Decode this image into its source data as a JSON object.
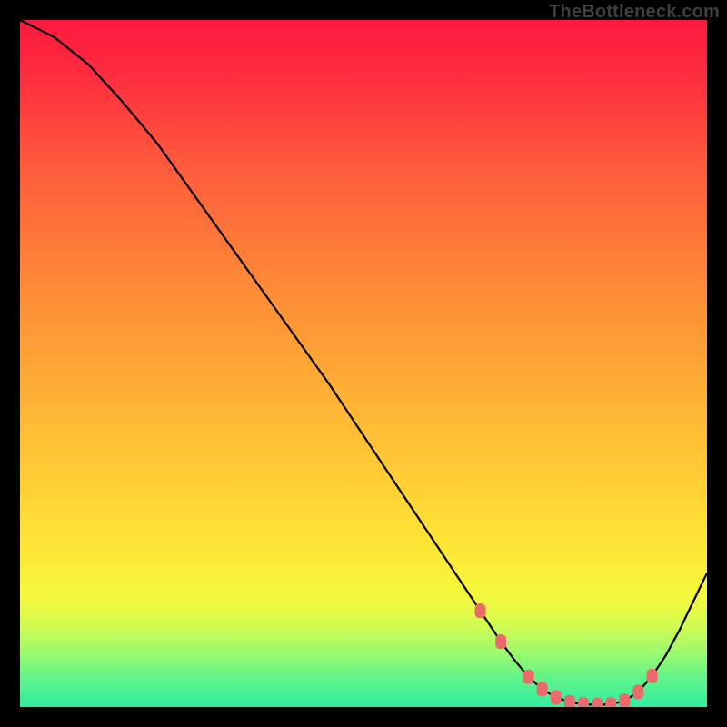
{
  "watermark": "TheBottleneck.com",
  "chart_data": {
    "type": "line",
    "title": "",
    "xlabel": "",
    "ylabel": "",
    "x": [
      0,
      5,
      10,
      15,
      20,
      25,
      30,
      35,
      40,
      45,
      50,
      55,
      60,
      65,
      67,
      70,
      72,
      74,
      76,
      78,
      80,
      82,
      84,
      86,
      88,
      90,
      92,
      94,
      96,
      100
    ],
    "values": [
      100,
      97.5,
      93.5,
      88,
      82,
      75,
      68,
      61,
      54,
      47,
      39.5,
      32,
      24.5,
      17,
      14,
      9.5,
      6.8,
      4.4,
      2.6,
      1.4,
      0.7,
      0.4,
      0.3,
      0.4,
      0.9,
      2.2,
      4.5,
      7.5,
      11.2,
      19.5
    ],
    "xlim": [
      0,
      100
    ],
    "ylim": [
      0,
      100
    ],
    "notes": "Background vertical gradient from red (top) via yellow to green (bottom); axes not drawn as ticks.",
    "marker_points_x": [
      67,
      70,
      74,
      76,
      78,
      80,
      82,
      84,
      86,
      88,
      90,
      92
    ],
    "marker_points_y": [
      14,
      9.5,
      4.4,
      2.6,
      1.4,
      0.7,
      0.4,
      0.3,
      0.4,
      0.9,
      2.2,
      4.5
    ],
    "marker_color": "#ed6a6b"
  }
}
